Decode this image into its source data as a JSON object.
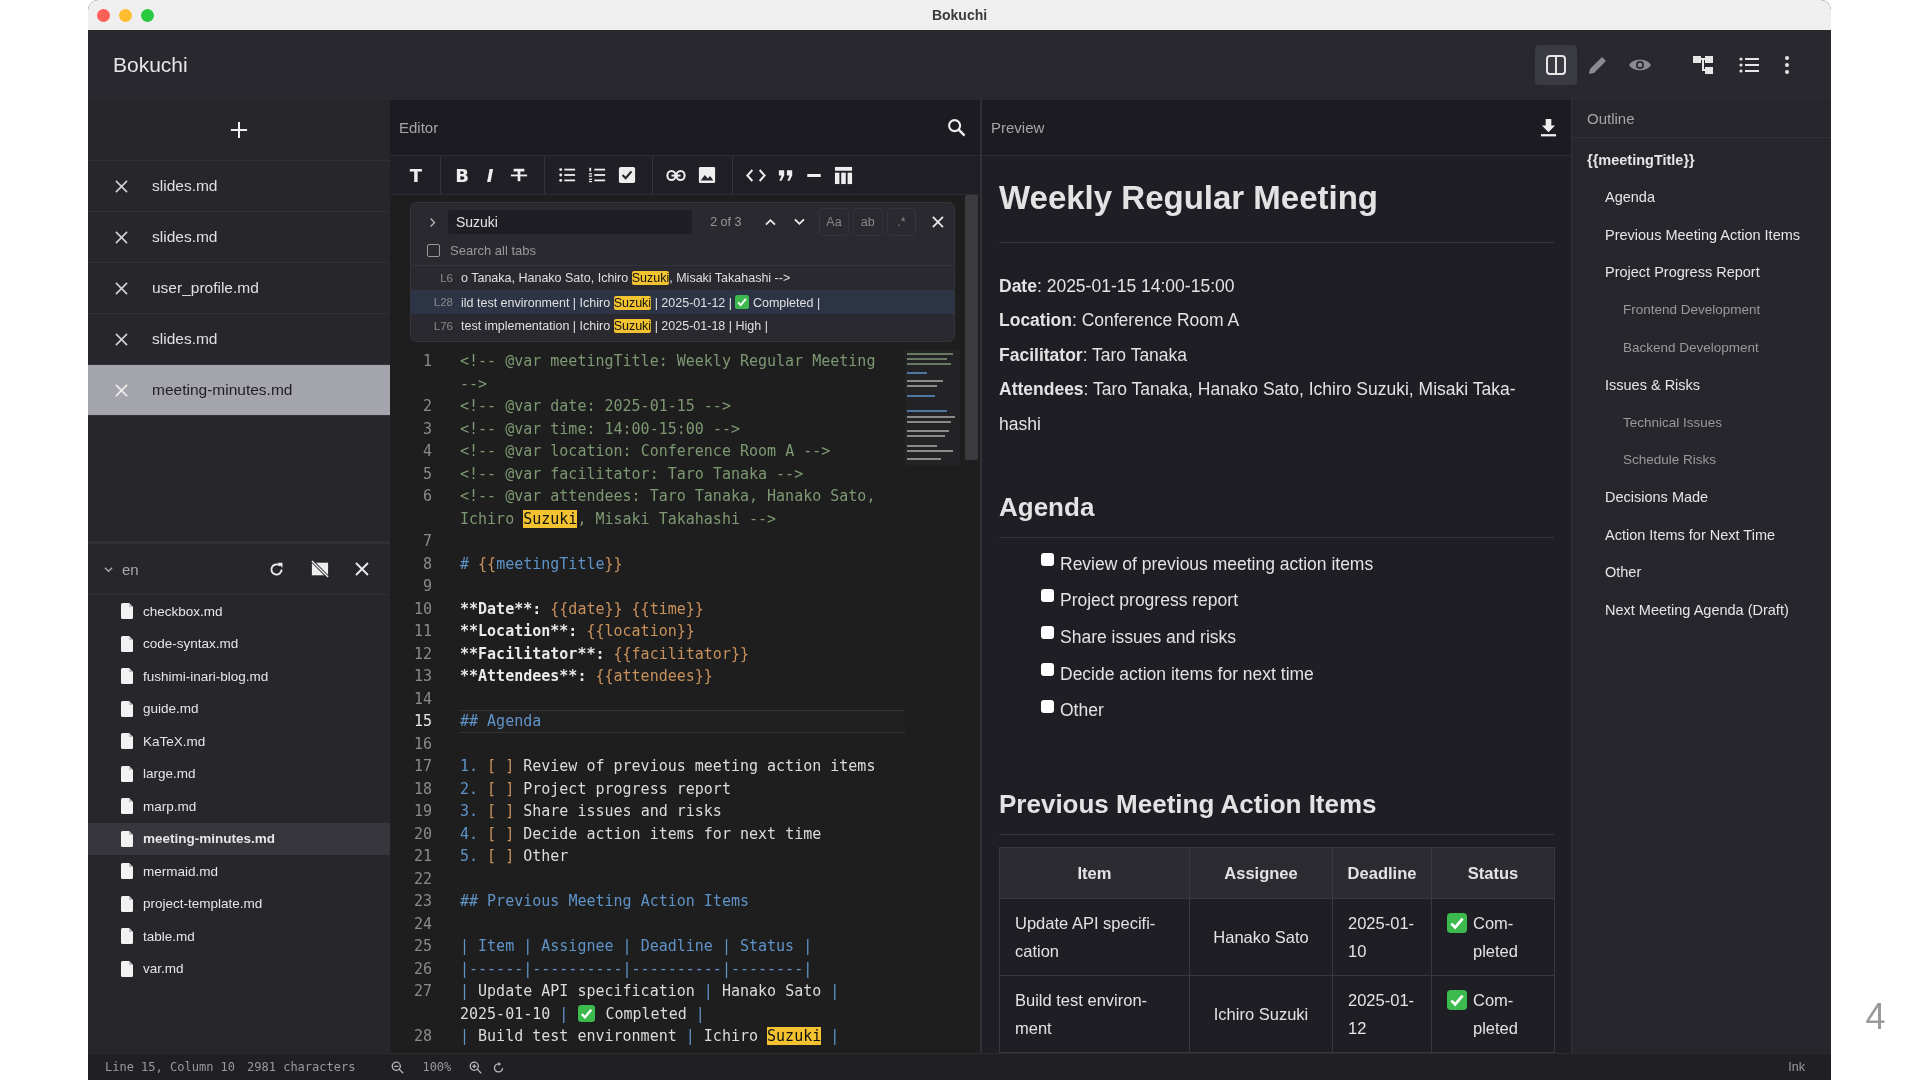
{
  "window": {
    "title": "Bokuchi"
  },
  "app": {
    "name": "Bokuchi"
  },
  "view_modes": [
    {
      "kind": "split",
      "selected": true
    },
    {
      "kind": "edit",
      "selected": false
    },
    {
      "kind": "preview",
      "selected": false
    }
  ],
  "tabs": [
    {
      "label": "slides.md",
      "selected": false
    },
    {
      "label": "slides.md",
      "selected": false
    },
    {
      "label": "user_profile.md",
      "selected": false
    },
    {
      "label": "slides.md",
      "selected": false
    },
    {
      "label": "meeting-minutes.md",
      "selected": true
    }
  ],
  "folder": {
    "name": "en",
    "expanded": true,
    "files": [
      {
        "name": "checkbox.md",
        "selected": false
      },
      {
        "name": "code-syntax.md",
        "selected": false
      },
      {
        "name": "fushimi-inari-blog.md",
        "selected": false
      },
      {
        "name": "guide.md",
        "selected": false
      },
      {
        "name": "KaTeX.md",
        "selected": false
      },
      {
        "name": "large.md",
        "selected": false
      },
      {
        "name": "marp.md",
        "selected": false
      },
      {
        "name": "meeting-minutes.md",
        "selected": true
      },
      {
        "name": "mermaid.md",
        "selected": false
      },
      {
        "name": "project-template.md",
        "selected": false
      },
      {
        "name": "table.md",
        "selected": false
      },
      {
        "name": "var.md",
        "selected": false
      }
    ]
  },
  "editor": {
    "title": "Editor",
    "toolbar": [
      {
        "kind": "heading",
        "glyph": "T"
      },
      {
        "kind": "bold",
        "glyph": "B"
      },
      {
        "kind": "italic",
        "glyph": "I"
      },
      {
        "kind": "strike"
      },
      {
        "kind": "bullets"
      },
      {
        "kind": "numbers"
      },
      {
        "kind": "task"
      },
      {
        "kind": "link"
      },
      {
        "kind": "image"
      },
      {
        "kind": "code"
      },
      {
        "kind": "quote"
      },
      {
        "kind": "rule"
      },
      {
        "kind": "table"
      }
    ],
    "search": {
      "value": "Suzuki",
      "count": "2 of 3",
      "search_all_tabs": false,
      "all_tabs_label": "Search all tabs",
      "options": [
        {
          "label": "Aa",
          "on": false
        },
        {
          "label": "ab",
          "on": false
        },
        {
          "label": ".*",
          "on": false
        }
      ],
      "results": [
        {
          "line": "L6",
          "selected": false,
          "segments": [
            {
              "kind": "text",
              "text": "o Tanaka, Hanako Sato, Ichiro "
            },
            {
              "kind": "match",
              "text": "Suzuki"
            },
            {
              "kind": "text",
              "text": ", Misaki Takahashi -->"
            }
          ]
        },
        {
          "line": "L28",
          "selected": true,
          "segments": [
            {
              "kind": "text",
              "text": "ild test environment | Ichiro "
            },
            {
              "kind": "match",
              "text": "Suzuki"
            },
            {
              "kind": "text",
              "text": " | 2025-01-12 | "
            },
            {
              "kind": "check"
            },
            {
              "kind": "text",
              "text": " Completed |"
            }
          ]
        },
        {
          "line": "L76",
          "selected": false,
          "segments": [
            {
              "kind": "text",
              "text": "test implementation | Ichiro "
            },
            {
              "kind": "match",
              "text": "Suzuki"
            },
            {
              "kind": "text",
              "text": " | 2025-01-18 | High |"
            }
          ]
        }
      ]
    },
    "lines": [
      {
        "number": "1",
        "current": false,
        "segments": [
          {
            "kind": "comment",
            "text": "<!-- @var meetingTitle: Weekly Regular Meeting -->"
          }
        ]
      },
      {
        "number": "2",
        "current": false,
        "segments": [
          {
            "kind": "comment",
            "text": "<!-- @var date: 2025-01-15 -->"
          }
        ]
      },
      {
        "number": "3",
        "current": false,
        "segments": [
          {
            "kind": "comment",
            "text": "<!-- @var time: 14:00-15:00 -->"
          }
        ]
      },
      {
        "number": "4",
        "current": false,
        "segments": [
          {
            "kind": "comment",
            "text": "<!-- @var location: Conference Room A -->"
          }
        ]
      },
      {
        "number": "5",
        "current": false,
        "segments": [
          {
            "kind": "comment",
            "text": "<!-- @var facilitator: Taro Tanaka -->"
          }
        ]
      },
      {
        "number": "6",
        "current": false,
        "segments": [
          {
            "kind": "comment",
            "text": "<!-- @var attendees: Taro Tanaka, Hanako Sato, Ichiro "
          },
          {
            "kind": "match",
            "text": "Suzuki"
          },
          {
            "kind": "comment",
            "text": ", Misaki Takahashi -->"
          }
        ]
      },
      {
        "number": "7",
        "current": false
      },
      {
        "number": "8",
        "current": false,
        "segments": [
          {
            "kind": "heading",
            "text": "# "
          },
          {
            "kind": "var",
            "text": "{{"
          },
          {
            "kind": "heading",
            "text": "meetingTitle"
          },
          {
            "kind": "var",
            "text": "}}"
          }
        ]
      },
      {
        "number": "9",
        "current": false
      },
      {
        "number": "10",
        "current": false,
        "segments": [
          {
            "kind": "bold",
            "text": "**Date**:"
          },
          {
            "kind": "var",
            "text": " {{date}} {{time}}"
          }
        ]
      },
      {
        "number": "11",
        "current": false,
        "segments": [
          {
            "kind": "bold",
            "text": "**Location**:"
          },
          {
            "kind": "var",
            "text": " {{location}}"
          }
        ]
      },
      {
        "number": "12",
        "current": false,
        "segments": [
          {
            "kind": "bold",
            "text": "**Facilitator**:"
          },
          {
            "kind": "var",
            "text": " {{facilitator}}"
          }
        ]
      },
      {
        "number": "13",
        "current": false,
        "segments": [
          {
            "kind": "bold",
            "text": "**Attendees**:"
          },
          {
            "kind": "var",
            "text": " {{attendees}}"
          }
        ]
      },
      {
        "number": "14",
        "current": false
      },
      {
        "number": "15",
        "current": true,
        "segments": [
          {
            "kind": "heading",
            "text": "## Agenda"
          }
        ]
      },
      {
        "number": "16",
        "current": false
      },
      {
        "number": "17",
        "current": false,
        "segments": [
          {
            "kind": "marker",
            "text": "1. "
          },
          {
            "kind": "box",
            "text": "[ ]"
          },
          {
            "kind": "plain",
            "text": " Review of previous meeting action items"
          }
        ]
      },
      {
        "number": "18",
        "current": false,
        "segments": [
          {
            "kind": "marker",
            "text": "2. "
          },
          {
            "kind": "box",
            "text": "[ ]"
          },
          {
            "kind": "plain",
            "text": " Project progress report"
          }
        ]
      },
      {
        "number": "19",
        "current": false,
        "segments": [
          {
            "kind": "marker",
            "text": "3. "
          },
          {
            "kind": "box",
            "text": "[ ]"
          },
          {
            "kind": "plain",
            "text": " Share issues and risks"
          }
        ]
      },
      {
        "number": "20",
        "current": false,
        "segments": [
          {
            "kind": "marker",
            "text": "4. "
          },
          {
            "kind": "box",
            "text": "[ ]"
          },
          {
            "kind": "plain",
            "text": " Decide action items for next time"
          }
        ]
      },
      {
        "number": "21",
        "current": false,
        "segments": [
          {
            "kind": "marker",
            "text": "5. "
          },
          {
            "kind": "box",
            "text": "[ ]"
          },
          {
            "kind": "plain",
            "text": " Other"
          }
        ]
      },
      {
        "number": "22",
        "current": false
      },
      {
        "number": "23",
        "current": false,
        "segments": [
          {
            "kind": "heading",
            "text": "## Previous Meeting Action Items"
          }
        ]
      },
      {
        "number": "24",
        "current": false
      },
      {
        "number": "25",
        "current": false,
        "segments": [
          {
            "kind": "heading",
            "text": "| Item | Assignee | Deadline | Status |"
          }
        ]
      },
      {
        "number": "26",
        "current": false,
        "segments": [
          {
            "kind": "heading",
            "text": "|------|----------|----------|--------|"
          }
        ]
      },
      {
        "number": "27",
        "current": false,
        "segments": [
          {
            "kind": "pipe",
            "text": "| "
          },
          {
            "kind": "plain",
            "text": "Update API specification "
          },
          {
            "kind": "pipe",
            "text": "| "
          },
          {
            "kind": "plain",
            "text": "Hanako Sato "
          },
          {
            "kind": "pipe",
            "text": "| "
          },
          {
            "kind": "plain",
            "text": "2025-01-10 "
          },
          {
            "kind": "pipe",
            "text": "| "
          },
          {
            "kind": "check"
          },
          {
            "kind": "plain",
            "text": " Completed "
          },
          {
            "kind": "pipe",
            "text": "|"
          }
        ]
      },
      {
        "number": "28",
        "current": false,
        "segments": [
          {
            "kind": "pipe",
            "text": "| "
          },
          {
            "kind": "plain",
            "text": "Build test environment "
          },
          {
            "kind": "pipe",
            "text": "| "
          },
          {
            "kind": "plain",
            "text": "Ichiro "
          },
          {
            "kind": "match",
            "text": "Suzuki"
          },
          {
            "kind": "pipe",
            "text": " |"
          }
        ]
      }
    ]
  },
  "preview": {
    "title": "Preview",
    "heading": "Weekly Regular Meeting",
    "meta": [
      "**Date**: 2025-01-15 14:00-15:00",
      "**Location**: Conference Room A",
      "**Facilitator**: Taro Tanaka",
      "**Attendees**: Taro Tanaka, Hanako Sato, Ichiro Suzuki, Misaki Taka-hashi"
    ],
    "agenda_heading": "Agenda",
    "agenda": [
      {
        "text": "Review of previous meeting action items",
        "checked": false
      },
      {
        "text": "Project progress report",
        "checked": false
      },
      {
        "text": "Share issues and risks",
        "checked": false
      },
      {
        "text": "Decide action items for next time",
        "checked": false
      },
      {
        "text": "Other",
        "checked": false
      }
    ],
    "table_heading": "Previous Meeting Action Items",
    "table": {
      "columns": [
        "Item",
        "Assignee",
        "Deadline",
        "Status"
      ],
      "rows": [
        {
          "item": "Update API specifi-cation",
          "assignee": "Hanako Sato",
          "deadline": "2025-01-10",
          "status": {
            "kind": "completed",
            "text": "Com-pleted"
          }
        },
        {
          "item": "Build test environ-ment",
          "assignee": "Ichiro Suzuki",
          "deadline": "2025-01-12",
          "status": {
            "kind": "completed",
            "text": "Com-pleted"
          }
        }
      ]
    }
  },
  "outline": {
    "title": "Outline",
    "items": [
      {
        "label": "{{meetingTitle}}",
        "children": [
          {
            "label": "Agenda"
          },
          {
            "label": "Previous Meeting Action Items"
          },
          {
            "label": "Project Progress Report",
            "children": [
              {
                "label": "Frontend Development"
              },
              {
                "label": "Backend Development"
              }
            ]
          },
          {
            "label": "Issues & Risks",
            "children": [
              {
                "label": "Technical Issues"
              },
              {
                "label": "Schedule Risks"
              }
            ]
          },
          {
            "label": "Decisions Made"
          },
          {
            "label": "Action Items for Next Time"
          },
          {
            "label": "Other"
          },
          {
            "label": "Next Meeting Agenda (Draft)"
          }
        ]
      }
    ]
  },
  "status_bar": {
    "position": "Line 15, Column 10",
    "characters": "2981 characters",
    "zoom": "100%",
    "theme": "Ink"
  },
  "page_number": "4"
}
